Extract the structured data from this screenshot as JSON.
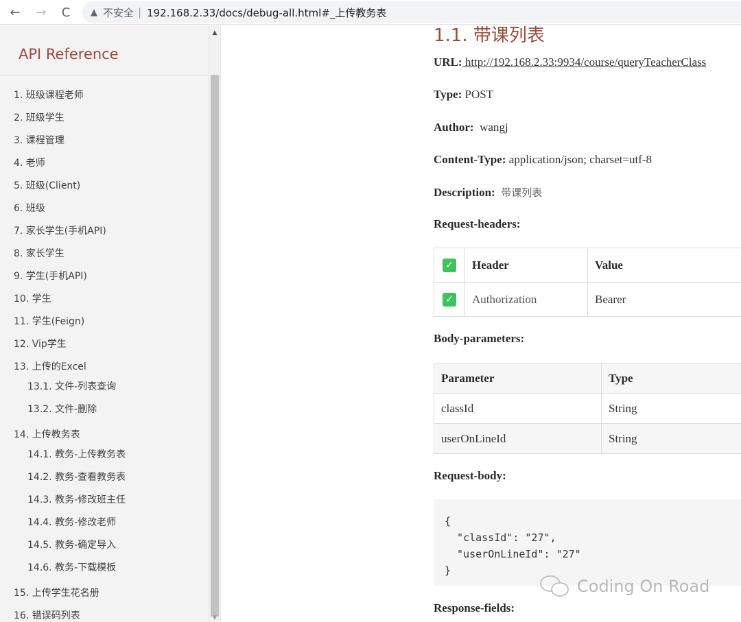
{
  "browser": {
    "back_icon": "←",
    "forward_icon": "→",
    "reload_icon": "C",
    "warning_icon": "▲",
    "security_label": "不安全",
    "separator": "|",
    "url": "192.168.2.33/docs/debug-all.html#_上传教务表"
  },
  "sidebar": {
    "title": "API Reference",
    "scroll_up_icon": "▲",
    "scroll_down_icon": "▼",
    "items": [
      {
        "label": "1. 班级课程老师",
        "level": 1
      },
      {
        "label": "2. 班级学生",
        "level": 1
      },
      {
        "label": "3. 课程管理",
        "level": 1
      },
      {
        "label": "4. 老师",
        "level": 1
      },
      {
        "label": "5. 班级(Client)",
        "level": 1
      },
      {
        "label": "6. 班级",
        "level": 1
      },
      {
        "label": "7. 家长学生(手机API)",
        "level": 1
      },
      {
        "label": "8. 家长学生",
        "level": 1
      },
      {
        "label": "9. 学生(手机API)",
        "level": 1
      },
      {
        "label": "10. 学生",
        "level": 1
      },
      {
        "label": "11. 学生(Feign)",
        "level": 1
      },
      {
        "label": "12. Vip学生",
        "level": 1
      },
      {
        "label": "13. 上传的Excel",
        "level": 1
      },
      {
        "label": "13.1. 文件-列表查询",
        "level": 2
      },
      {
        "label": "13.2. 文件-删除",
        "level": 2
      },
      {
        "label": "14. 上传教务表",
        "level": 1
      },
      {
        "label": "14.1. 教务-上传教务表",
        "level": 2
      },
      {
        "label": "14.2. 教务-查看教务表",
        "level": 2
      },
      {
        "label": "14.3. 教务-修改班主任",
        "level": 2
      },
      {
        "label": "14.4. 教务-修改老师",
        "level": 2
      },
      {
        "label": "14.5. 教务-确定导入",
        "level": 2
      },
      {
        "label": "14.6. 教务-下载模板",
        "level": 2
      },
      {
        "label": "15. 上传学生花名册",
        "level": 1
      },
      {
        "label": "16. 错误码列表",
        "level": 1
      }
    ]
  },
  "main": {
    "title": "1.1. 带课列表",
    "url_label": "URL:",
    "url_value": " http://192.168.2.33:9934/course/queryTeacherClass",
    "type_label": "Type:",
    "type_value": "POST",
    "author_label": "Author:",
    "author_value": "wangj",
    "content_type_label": "Content-Type:",
    "content_type_value": "application/json; charset=utf-8",
    "description_label": "Description:",
    "description_value": "带课列表",
    "request_headers_heading": "Request-headers:",
    "headers_table": {
      "columns": [
        "Header",
        "Value"
      ],
      "rows": [
        {
          "header": "Authorization",
          "value": "Bearer"
        }
      ],
      "check_icon": "✓"
    },
    "body_parameters_heading": "Body-parameters:",
    "body_table": {
      "columns": [
        "Parameter",
        "Type"
      ],
      "rows": [
        {
          "parameter": "classId",
          "type": "String"
        },
        {
          "parameter": "userOnLineId",
          "type": "String"
        }
      ]
    },
    "request_body_heading": "Request-body:",
    "request_body_lines": [
      "{",
      "  \"classId\": \"27\",",
      "  \"userOnLineId\": \"27\"",
      "}"
    ],
    "response_fields_heading": "Response-fields:",
    "watermark_text": "Coding On Road"
  }
}
